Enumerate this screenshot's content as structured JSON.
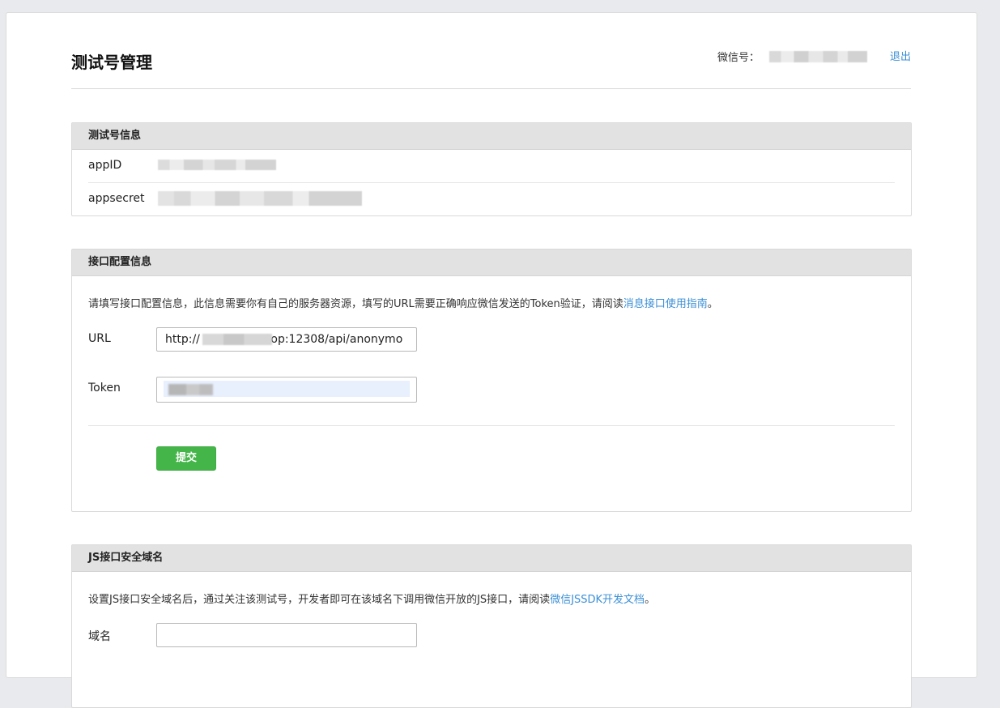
{
  "header": {
    "title": "测试号管理",
    "wechat_label": "微信号：",
    "logout": "退出"
  },
  "test_info": {
    "title": "测试号信息",
    "appid_label": "appID",
    "appsecret_label": "appsecret"
  },
  "interface_config": {
    "title": "接口配置信息",
    "description": "请填写接口配置信息，此信息需要你有自己的服务器资源，填写的URL需要正确响应微信发送的Token验证，请阅读",
    "link": "消息接口使用指南",
    "period": "。",
    "url_label": "URL",
    "url_prefix": "http://",
    "url_suffix": "top:12308/api/anonymo",
    "token_label": "Token",
    "submit": "提交"
  },
  "js_domain": {
    "title": "JS接口安全域名",
    "description": "设置JS接口安全域名后，通过关注该测试号，开发者即可在该域名下调用微信开放的JS接口，请阅读",
    "link": "微信JSSDK开发文档",
    "period": "。",
    "domain_label": "域名",
    "domain_value": ""
  },
  "colors": {
    "accent_link": "#3b8fd6",
    "button_green": "#44b549",
    "panel_header": "#e2e2e2",
    "background": "#e9eaed"
  }
}
